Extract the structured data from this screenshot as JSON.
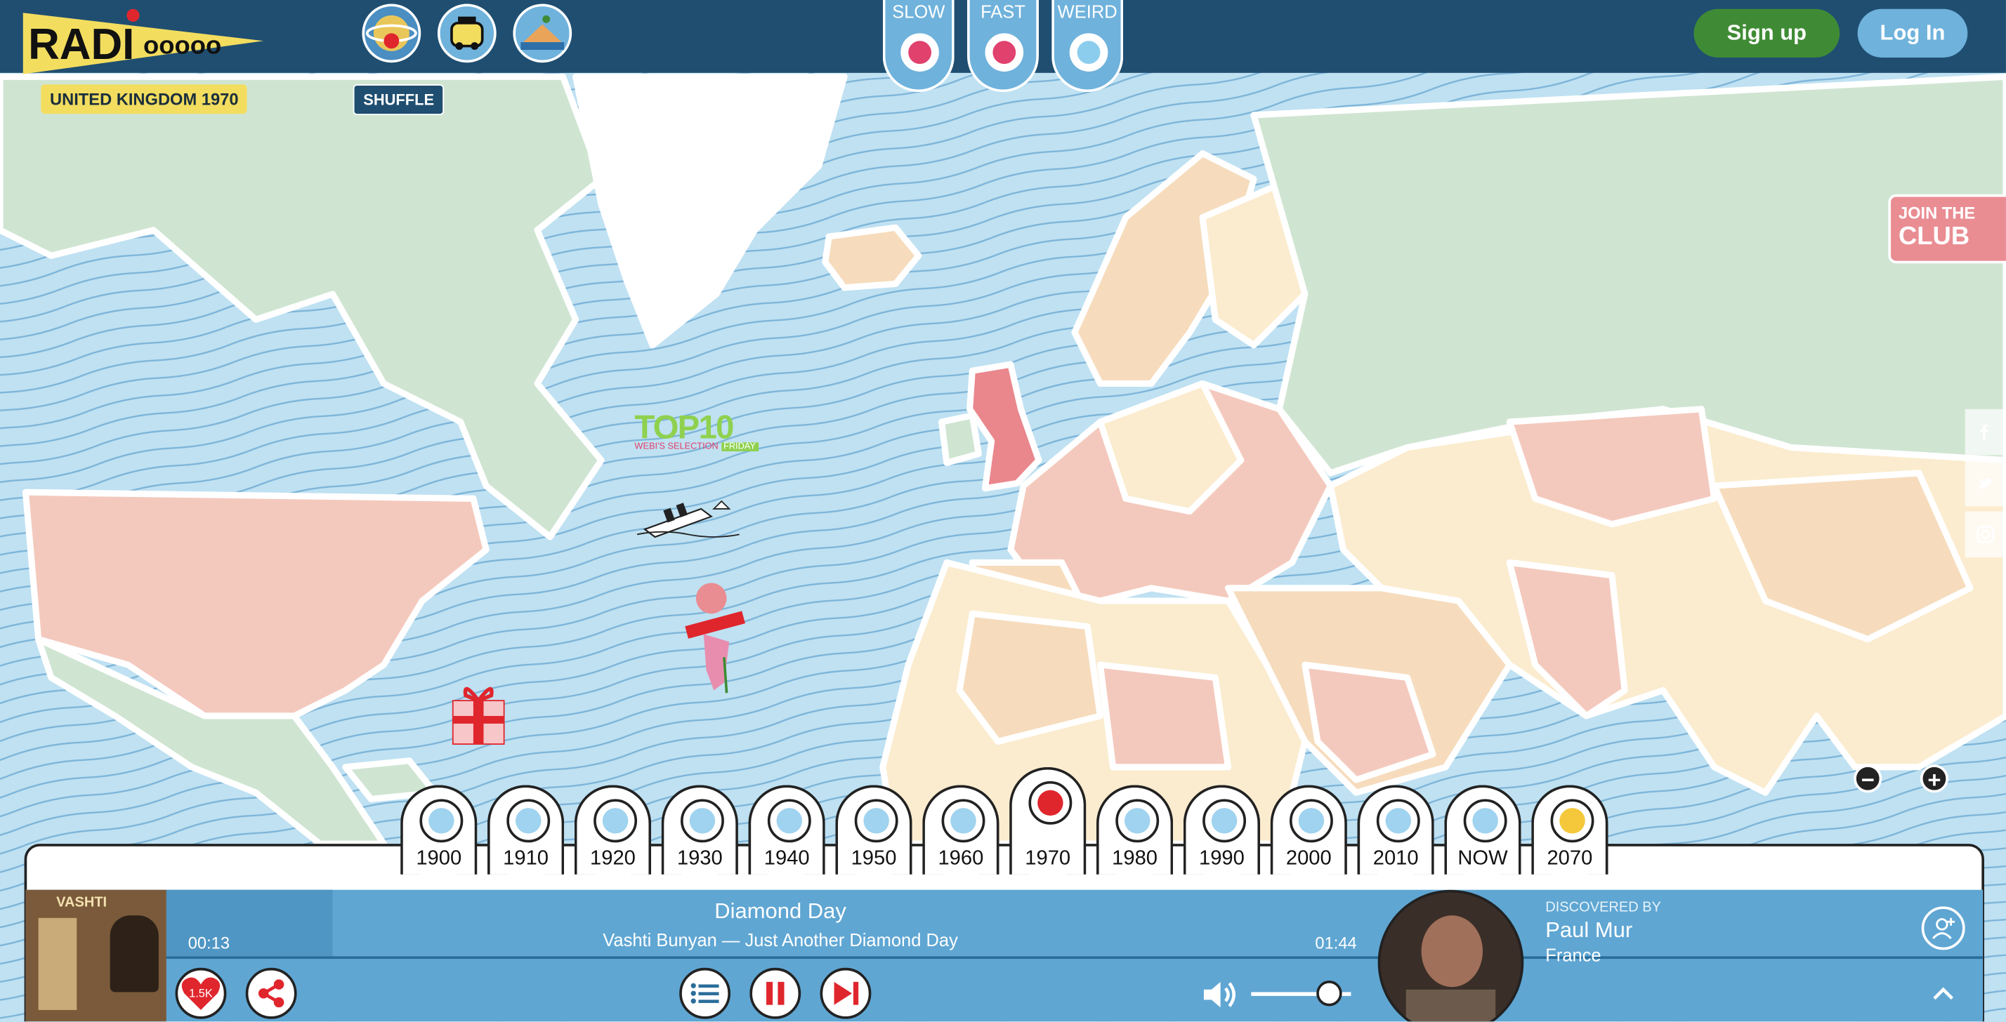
{
  "brand": {
    "logo_text": "RADIOOOOO"
  },
  "location": {
    "country": "UNITED KINGDOM",
    "decade": "1970"
  },
  "shuffle_label": "SHUFFLE",
  "speed": [
    {
      "label": "SLOW",
      "color": "#e0416d"
    },
    {
      "label": "FAST",
      "color": "#e0416d"
    },
    {
      "label": "WEIRD",
      "color": "#8ccdee"
    }
  ],
  "auth": {
    "signup": "Sign up",
    "login": "Log In",
    "signup_color": "#3f8b35",
    "login_color": "#6fb2dc"
  },
  "club": {
    "line1": "JOIN THE",
    "line2": "CLUB"
  },
  "top10": {
    "title": "TOP10",
    "sub1": "WEBI'S SELECTION",
    "sub2": "FRIDAY"
  },
  "decades": [
    {
      "label": "1900",
      "dot": "#9fd3ef"
    },
    {
      "label": "1910",
      "dot": "#9fd3ef"
    },
    {
      "label": "1920",
      "dot": "#9fd3ef"
    },
    {
      "label": "1930",
      "dot": "#9fd3ef"
    },
    {
      "label": "1940",
      "dot": "#9fd3ef"
    },
    {
      "label": "1950",
      "dot": "#9fd3ef"
    },
    {
      "label": "1960",
      "dot": "#9fd3ef"
    },
    {
      "label": "1970",
      "dot": "#e0262d",
      "active": true
    },
    {
      "label": "1980",
      "dot": "#9fd3ef"
    },
    {
      "label": "1990",
      "dot": "#9fd3ef"
    },
    {
      "label": "2000",
      "dot": "#9fd3ef"
    },
    {
      "label": "2010",
      "dot": "#9fd3ef"
    },
    {
      "label": "NOW",
      "dot": "#9fd3ef"
    },
    {
      "label": "2070",
      "dot": "#f4c83a"
    }
  ],
  "player": {
    "elapsed": "00:13",
    "duration": "01:44",
    "title": "Diamond Day",
    "subtitle": "Vashti Bunyan — Just Another Diamond Day",
    "likes": "1.5K",
    "cover_text": "VASHTI",
    "discovered_by_label": "DISCOVERED BY",
    "discoverer": "Paul Mur",
    "discoverer_country": "France",
    "volume": 0.78
  }
}
